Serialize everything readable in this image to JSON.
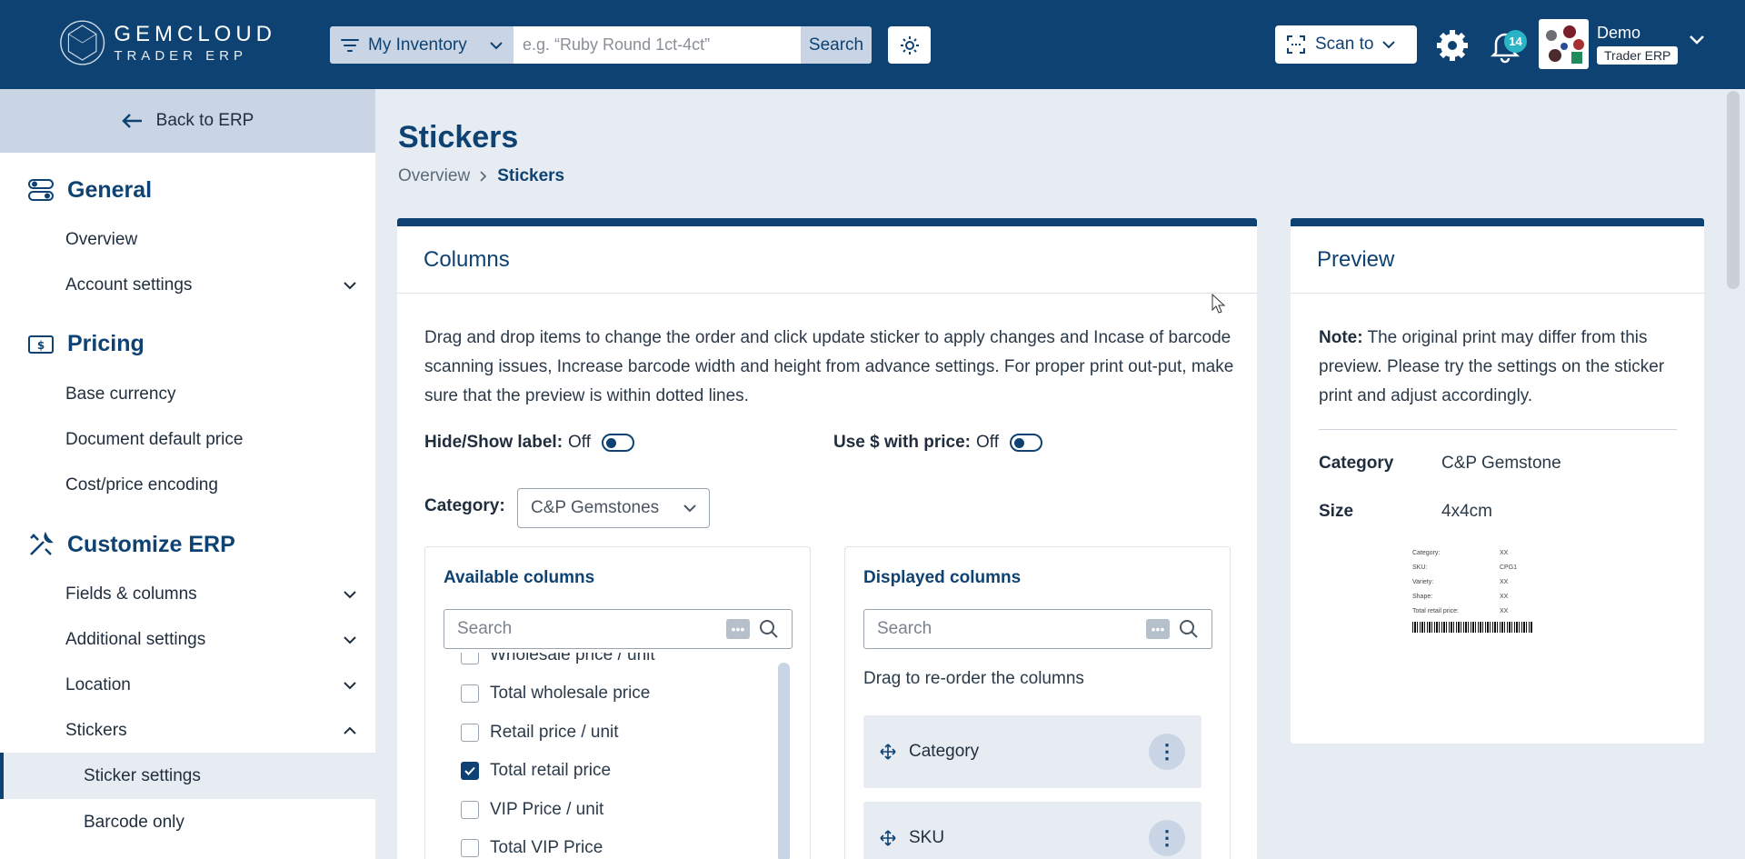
{
  "brand": {
    "line1": "GEMCLOUD",
    "line2": "TRADER ERP"
  },
  "topbar": {
    "inventory_select": "My Inventory",
    "search_placeholder": "e.g. “Ruby Round 1ct-4ct”",
    "search_button": "Search",
    "scan_to": "Scan to",
    "notification_count": "14",
    "user_name": "Demo",
    "user_role": "Trader ERP"
  },
  "sidebar": {
    "back": "Back to ERP",
    "sections": [
      {
        "title": "General",
        "items": [
          "Overview",
          "Account settings"
        ]
      },
      {
        "title": "Pricing",
        "items": [
          "Base currency",
          "Document default price",
          "Cost/price encoding"
        ]
      },
      {
        "title": "Customize ERP",
        "items": [
          "Fields & columns",
          "Additional settings",
          "Location",
          "Stickers"
        ]
      }
    ],
    "sub_items": [
      "Sticker settings",
      "Barcode only"
    ]
  },
  "page": {
    "title": "Stickers",
    "breadcrumb": [
      "Overview",
      "Stickers"
    ]
  },
  "columns_card": {
    "title": "Columns",
    "description": "Drag and drop items to change the order and click update sticker to apply changes and Incase of barcode scanning issues, Increase barcode width and height from advance settings. For proper print out-put, make sure that the preview is within dotted lines.",
    "hide_show_label": "Hide/Show label:",
    "hide_show_state": "Off",
    "use_dollar_label": "Use $ with price:",
    "use_dollar_state": "Off",
    "category_label": "Category:",
    "category_value": "C&P Gemstones",
    "available": {
      "title": "Available columns",
      "search_placeholder": "Search",
      "items": [
        {
          "label": "Wholesale price / unit",
          "checked": false
        },
        {
          "label": "Total wholesale price",
          "checked": false
        },
        {
          "label": "Retail price / unit",
          "checked": false
        },
        {
          "label": "Total retail price",
          "checked": true
        },
        {
          "label": "VIP Price / unit",
          "checked": false
        },
        {
          "label": "Total VIP Price",
          "checked": false
        }
      ]
    },
    "displayed": {
      "title": "Displayed columns",
      "search_placeholder": "Search",
      "hint": "Drag to re-order the columns",
      "items": [
        "Category",
        "SKU"
      ]
    }
  },
  "preview_card": {
    "title": "Preview",
    "note_label": "Note:",
    "note_text": " The original print may differ from this preview. Please try the settings on the sticker print and adjust accordingly.",
    "category_label": "Category",
    "category_value": "C&P Gemstone",
    "size_label": "Size",
    "size_value": "4x4cm",
    "sticker": [
      {
        "k": "Category:",
        "v": "XX"
      },
      {
        "k": "SKU:",
        "v": "CPG1"
      },
      {
        "k": "Variety:",
        "v": "XX"
      },
      {
        "k": "Shape:",
        "v": "XX"
      },
      {
        "k": "Total retail price:",
        "v": "XX"
      }
    ]
  },
  "colors": {
    "primary": "#0e4272",
    "accent": "#2bb3c6",
    "surface": "#e7ecf3",
    "muted": "#c9d5e4"
  }
}
